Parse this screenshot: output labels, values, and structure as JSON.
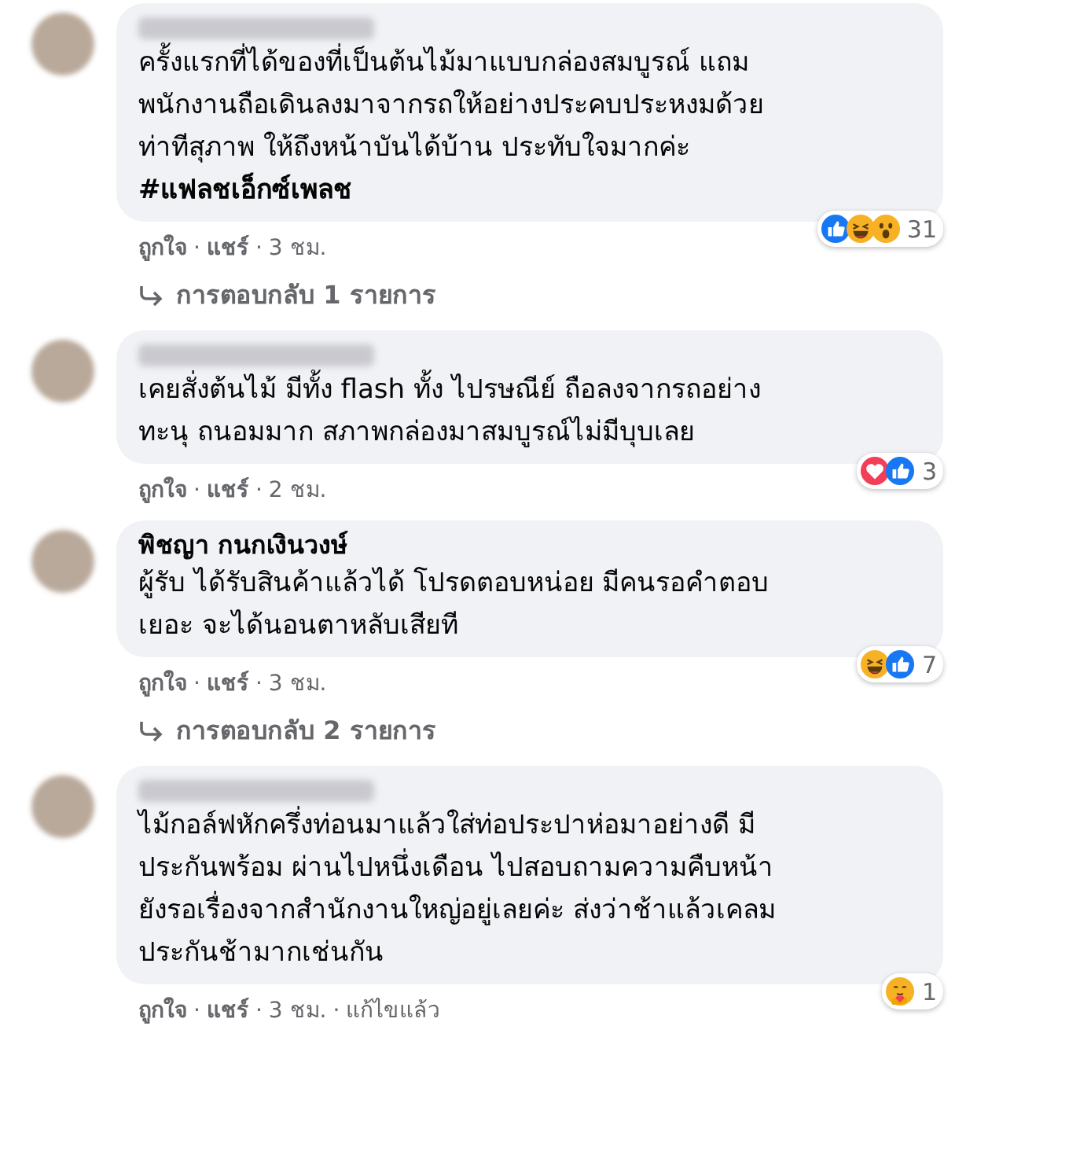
{
  "separator": "·",
  "comments": [
    {
      "lines": [
        "ครั้งแรกที่ได้ของที่เป็นต้นไม้มาแบบกล่องสมบูรณ์ แถม",
        "พนักงานถือเดินลงมาจากรถให้อย่างประคบประหงมด้วย",
        "ท่าทีสุภาพ ให้ถึงหน้าบันได้บ้าน ประทับใจมากค่ะ",
        "**#แฟลชเอ็กซ์เพลช**"
      ],
      "reactions": [
        {
          "kind": "like"
        },
        {
          "kind": "haha"
        },
        {
          "kind": "wow"
        }
      ],
      "reaction_count": "31",
      "actions": [
        "ถูกใจ",
        "แชร์"
      ],
      "time": "3 ชม.",
      "replies": "การตอบกลับ 1 รายการ"
    },
    {
      "lines": [
        "เคยสั่งต้นไม้ มีทั้ง flash ทั้ง ไปรษณีย์ ถือลงจากรถอย่าง",
        "ทะนุ ถนอมมาก สภาพกล่องมาสมบูรณ์ไม่มีบุบเลย"
      ],
      "reactions": [
        {
          "kind": "love"
        },
        {
          "kind": "like"
        }
      ],
      "reaction_count": "3",
      "actions": [
        "ถูกใจ",
        "แชร์"
      ],
      "time": "2 ชม."
    },
    {
      "author": "พิชญา กนกเงินวงษ์",
      "lines": [
        "ผู้รับ ได้รับสินค้าแล้วได้ โปรดตอบหน่อย มีคนรอคำตอบ",
        "เยอะ จะได้นอนตาหลับเสียที"
      ],
      "reactions": [
        {
          "kind": "haha"
        },
        {
          "kind": "like"
        }
      ],
      "reaction_count": "7",
      "actions": [
        "ถูกใจ",
        "แชร์"
      ],
      "time": "3 ชม.",
      "replies": "การตอบกลับ 2 รายการ"
    },
    {
      "lines": [
        "ไม้กอล์ฟหักครึ่งท่อนมาแล้วใส่ท่อประปาห่อมาอย่างดี มี",
        "ประกันพร้อม ผ่านไปหนึ่งเดือน ไปสอบถามความคืบหน้า",
        "ยังรอเรื่องจากสำนักงานใหญ่อยู่เลยค่ะ ส่งว่าช้าแล้วเคลม",
        "ประกันช้ามากเช่นกัน"
      ],
      "reactions": [
        {
          "kind": "care"
        }
      ],
      "reaction_count": "1",
      "actions": [
        "ถูกใจ",
        "แชร์"
      ],
      "time": "3 ชม.",
      "edited": "แก้ไขแล้ว"
    }
  ]
}
